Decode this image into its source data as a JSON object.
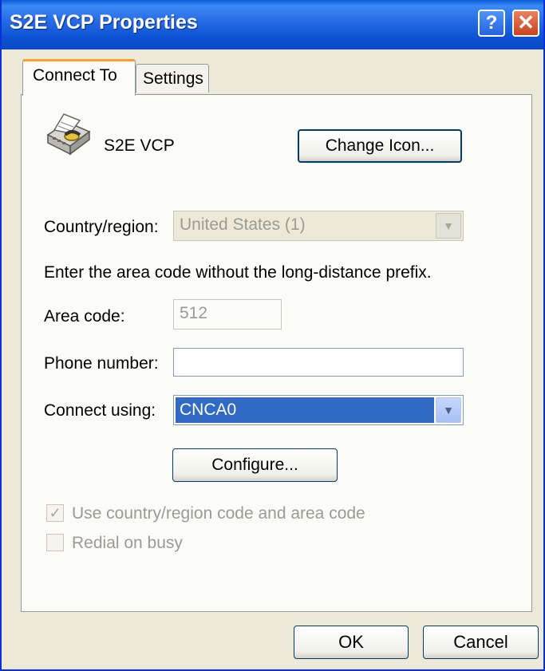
{
  "window": {
    "title": "S2E VCP Properties",
    "help_label": "?",
    "close_label": "✕"
  },
  "tabs": [
    {
      "label": "Connect To"
    },
    {
      "label": "Settings"
    }
  ],
  "connection": {
    "name": "S2E VCP",
    "icon": "telephone-fax-icon"
  },
  "buttons": {
    "change_icon": "Change Icon...",
    "configure": "Configure...",
    "ok": "OK",
    "cancel": "Cancel"
  },
  "form": {
    "country_label": "Country/region:",
    "country_value": "United States (1)",
    "instruction": "Enter the area code without the long-distance prefix.",
    "area_code_label": "Area code:",
    "area_code_value": "512",
    "phone_label": "Phone number:",
    "phone_value": "",
    "connect_using_label": "Connect using:",
    "connect_using_value": "CNCA0"
  },
  "checkboxes": [
    {
      "label": "Use country/region code and area code",
      "checked": true,
      "enabled": false
    },
    {
      "label": "Redial on busy",
      "checked": false,
      "enabled": false
    }
  ],
  "colors": {
    "title_bar": "#0a5bd6",
    "selection": "#316ac5",
    "tab_highlight": "#ff9e2e"
  }
}
